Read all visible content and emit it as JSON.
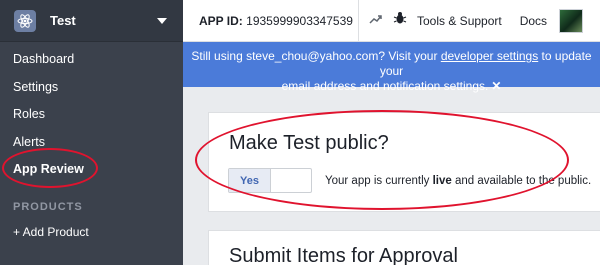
{
  "sidebar": {
    "app_name": "Test",
    "items": [
      {
        "label": "Dashboard"
      },
      {
        "label": "Settings"
      },
      {
        "label": "Roles"
      },
      {
        "label": "Alerts"
      },
      {
        "label": "App Review"
      }
    ],
    "products_label": "PRODUCTS",
    "add_product_label": "+ Add Product"
  },
  "topbar": {
    "app_id_label": "APP ID:",
    "app_id_value": "1935999903347539",
    "tools_label": "Tools & Support",
    "docs_label": "Docs"
  },
  "banner": {
    "text_1": "Still using steve_chou@yahoo.com? Visit your ",
    "link": "developer settings",
    "text_2": " to update your",
    "line_2": "email address and notification settings.",
    "close": "✕"
  },
  "main": {
    "public_title": "Make Test public?",
    "toggle_label": "Yes",
    "status_pre": "Your app is currently ",
    "status_live": "live",
    "status_post": " and available to the public.",
    "submit_title": "Submit Items for Approval"
  },
  "colors": {
    "sidebar_bg": "#3b414c",
    "banner_bg": "#4b7bd9",
    "annotation": "#e0132e",
    "toggle_text": "#4267b2"
  },
  "icons": [
    "app-icon",
    "caret-down-icon",
    "trend-icon",
    "bug-icon",
    "avatar"
  ]
}
